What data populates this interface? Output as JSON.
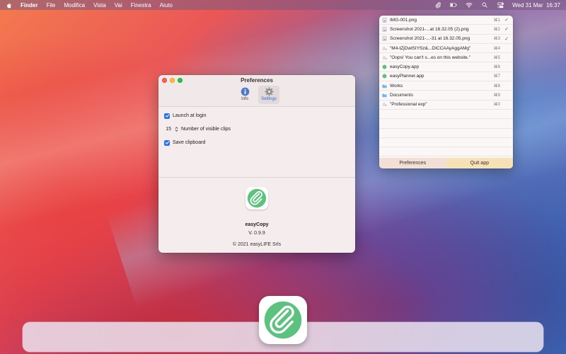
{
  "menubar": {
    "app_name": "Finder",
    "menus": [
      "File",
      "Modifica",
      "Vista",
      "Vai",
      "Finestra",
      "Aiuto"
    ],
    "clock": "Wed 31 Mar  16:37",
    "status_icons": [
      "easycopy-clip-icon",
      "battery-icon",
      "wifi-icon",
      "search-icon",
      "control-center-icon"
    ]
  },
  "prefs": {
    "title": "Preferences",
    "tabs": [
      {
        "label": "Info",
        "icon": "info-icon"
      },
      {
        "label": "Settings",
        "icon": "gear-icon"
      }
    ],
    "launch_at_login": "Launch at login",
    "visible_clips_value": "15",
    "visible_clips_label": "Number of visible clips",
    "save_clipboard": "Save clipboard",
    "app_name": "easyCopy",
    "version": "V. 0.9.9",
    "copyright": "© 2021 easyLIFE Srls"
  },
  "popup": {
    "items": [
      {
        "label": "IMG-001.png",
        "key": "⌘1",
        "check": "✓",
        "icon": "image-file-icon"
      },
      {
        "label": "Screenshot 2021-...at 16.32.05 (2).png",
        "key": "⌘2",
        "check": "✓",
        "icon": "image-file-icon"
      },
      {
        "label": "Screenshot 2021-...-31 at 16.32.05.png",
        "key": "⌘3",
        "check": "✓",
        "icon": "image-file-icon"
      },
      {
        "label": "\"M4-tZjDwlSIYSz&...DICCAAyAggAMg\"",
        "key": "⌘4",
        "check": "",
        "icon": "text-icon"
      },
      {
        "label": "\"Oops! You can't s...es on this website.\"",
        "key": "⌘5",
        "check": "",
        "icon": "text-icon"
      },
      {
        "label": "easyCopy.app",
        "key": "⌘6",
        "check": "",
        "icon": "app-icon"
      },
      {
        "label": "easyPlanner.app",
        "key": "⌘7",
        "check": "",
        "icon": "app-icon"
      },
      {
        "label": "Works",
        "key": "⌘8",
        "check": "",
        "icon": "folder-icon"
      },
      {
        "label": "Documents",
        "key": "⌘9",
        "check": "",
        "icon": "folder-icon"
      },
      {
        "label": "\"Professional exp\"",
        "key": "⌘0",
        "check": "",
        "icon": "text-icon"
      }
    ],
    "preferences_label": "Preferences",
    "quit_label": "Quit app"
  },
  "dock": {
    "app_icon": "easycopy-app-icon"
  }
}
